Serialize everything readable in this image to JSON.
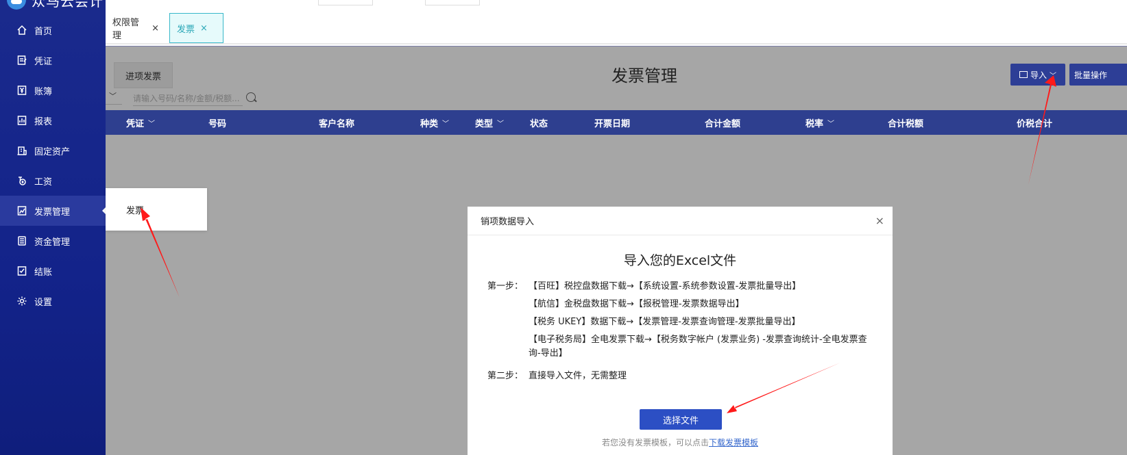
{
  "logo": {
    "text": "众马云会计"
  },
  "sidebar": {
    "items": [
      {
        "label": "首页",
        "icon": "home-icon"
      },
      {
        "label": "凭证",
        "icon": "voucher-icon"
      },
      {
        "label": "账簿",
        "icon": "ledger-icon"
      },
      {
        "label": "报表",
        "icon": "report-icon"
      },
      {
        "label": "固定资产",
        "icon": "asset-icon"
      },
      {
        "label": "工资",
        "icon": "salary-icon"
      },
      {
        "label": "发票管理",
        "icon": "invoice-icon",
        "active": true
      },
      {
        "label": "资金管理",
        "icon": "fund-icon"
      },
      {
        "label": "结账",
        "icon": "closing-icon"
      },
      {
        "label": "设置",
        "icon": "gear-icon"
      }
    ]
  },
  "tabs": [
    {
      "label": "权限管理",
      "close": "×"
    },
    {
      "label": "发票",
      "close": "×",
      "active": true
    }
  ],
  "page": {
    "title": "发票管理",
    "btn_jinxiang": "进项发票",
    "btn_import": "导入",
    "btn_batch": "批量操作",
    "search_placeholder": "请输入号码/名称/金额/税额..."
  },
  "table": {
    "headers": [
      "凭证",
      "号码",
      "客户名称",
      "种类",
      "类型",
      "状态",
      "开票日期",
      "合计金额",
      "税率",
      "合计税额",
      "价税合计"
    ]
  },
  "flyout": {
    "item": "发票"
  },
  "dialog": {
    "header": "销项数据导入",
    "close": "×",
    "title": "导入您的Excel文件",
    "step1_label": "第一步：",
    "step1_lines": [
      "【百旺】税控盘数据下载→【系统设置-系统参数设置-发票批量导出】",
      "【航信】金税盘数据下载→【报税管理-发票数据导出】",
      "【税务 UKEY】数据下载→【发票管理-发票查询管理-发票批量导出】",
      "【电子税务局】全电发票下载→【税务数字帐户 (发票业务) -发票查询统计-全电发票查询-导出】"
    ],
    "step2_label": "第二步：",
    "step2_text": "直接导入文件，无需整理",
    "choose_btn": "选择文件",
    "tip_text": "若您没有发票模板，可以点击",
    "tip_link": "下载发票模板"
  },
  "colors": {
    "sidebar": "#13238a",
    "accent": "#2d3e96",
    "arrow": "#ff1a1a"
  }
}
